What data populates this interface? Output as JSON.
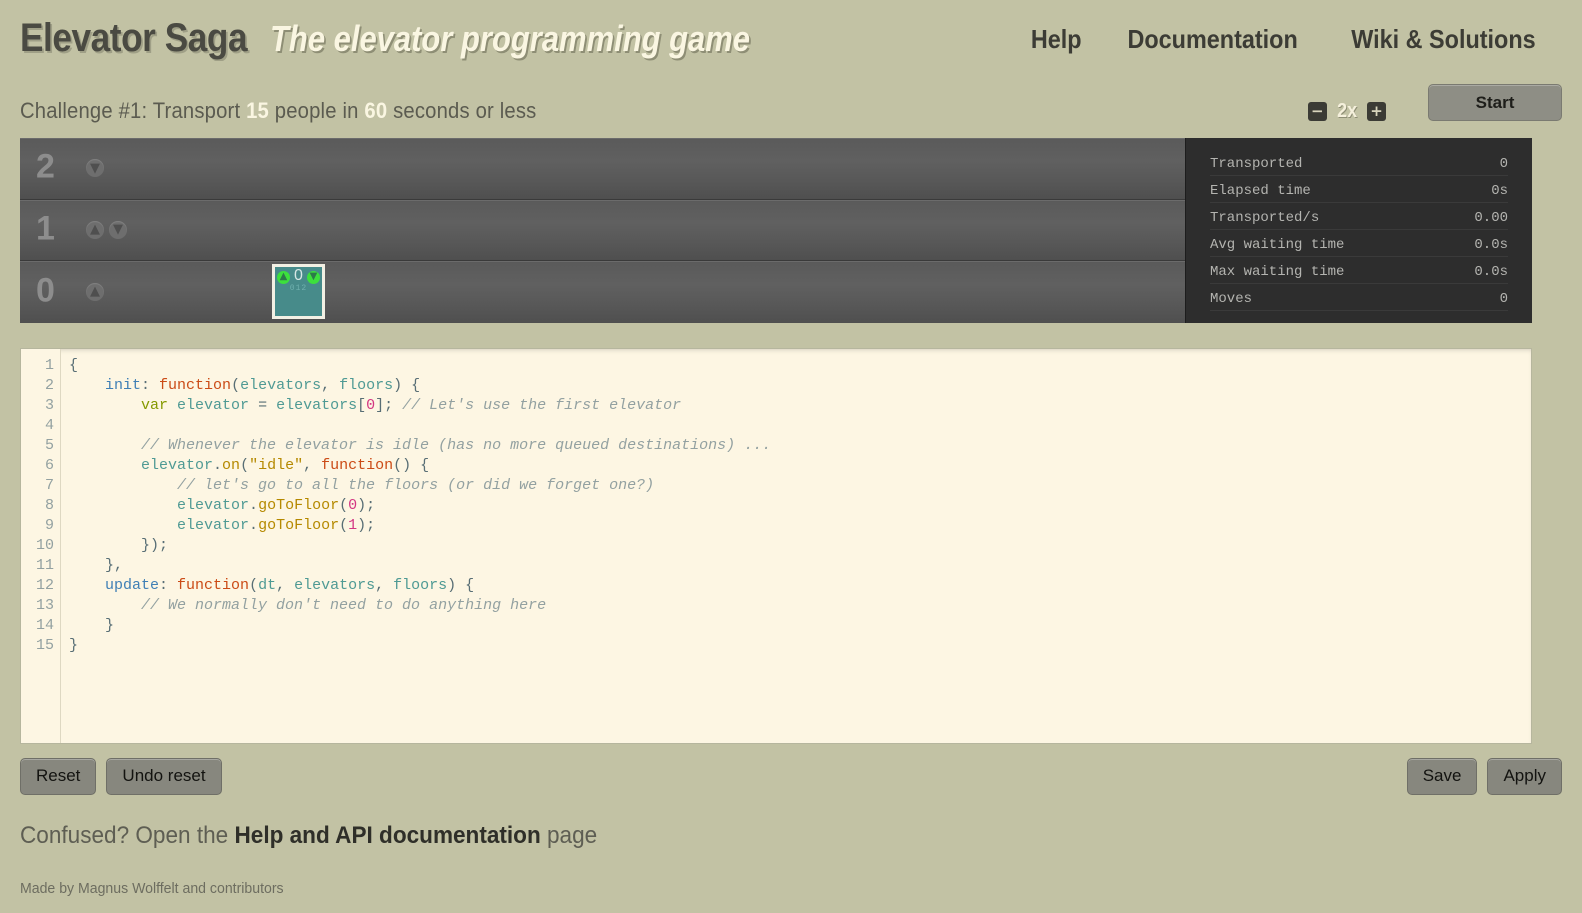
{
  "header": {
    "title_main": "Elevator Saga",
    "title_sub": "The elevator programming game",
    "nav": [
      {
        "label": "Help"
      },
      {
        "label": "Documentation"
      },
      {
        "label": "Wiki & Solutions"
      }
    ]
  },
  "challenge": {
    "prefix": "Challenge #1: Transport ",
    "people": "15",
    "middle": " people in ",
    "seconds": "60",
    "suffix": " seconds or less"
  },
  "controls": {
    "speed_down": "−",
    "speed_value": "2x",
    "speed_up": "+",
    "start_label": "Start"
  },
  "world": {
    "floors": [
      {
        "number": "2",
        "up": false,
        "down": true
      },
      {
        "number": "1",
        "up": true,
        "down": true
      },
      {
        "number": "0",
        "up": true,
        "down": false
      }
    ],
    "elevator": {
      "indicator_up": "↑",
      "indicator_down": "↓",
      "current_floor": "0",
      "destinations": "012"
    },
    "stats": [
      {
        "label": "Transported",
        "value": "0"
      },
      {
        "label": "Elapsed time",
        "value": "0s"
      },
      {
        "label": "Transported/s",
        "value": "0.00"
      },
      {
        "label": "Avg waiting time",
        "value": "0.0s"
      },
      {
        "label": "Max waiting time",
        "value": "0.0s"
      },
      {
        "label": "Moves",
        "value": "0"
      }
    ]
  },
  "editor": {
    "line_numbers": [
      "1",
      "2",
      "3",
      "4",
      "5",
      "6",
      "7",
      "8",
      "9",
      "10",
      "11",
      "12",
      "13",
      "14",
      "15"
    ],
    "code_text": "{\n    init: function(elevators, floors) {\n        var elevator = elevators[0]; // Let's use the first elevator\n\n        // Whenever the elevator is idle (has no more queued destinations) ...\n        elevator.on(\"idle\", function() {\n            // let's go to all the floors (or did we forget one?)\n            elevator.goToFloor(0);\n            elevator.goToFloor(1);\n        });\n    },\n    update: function(dt, elevators, floors) {\n        // We normally don't need to do anything here\n    }\n}"
  },
  "buttons": {
    "reset": "Reset",
    "undo_reset": "Undo reset",
    "save": "Save",
    "apply": "Apply"
  },
  "footer": {
    "confused_prefix": "Confused? Open the ",
    "confused_link": "Help and API documentation",
    "confused_suffix": " page",
    "made_by": "Made by Magnus Wolffelt and contributors"
  },
  "colors": {
    "page_bg": "#c2c2a4",
    "editor_bg": "#fdf6e3",
    "world_floor": "#5a5a5a",
    "stats_bg": "#2d2d2d",
    "elevator": "#478b8a",
    "indicator_green": "#3ce03c",
    "button_gray": "#87877e"
  }
}
